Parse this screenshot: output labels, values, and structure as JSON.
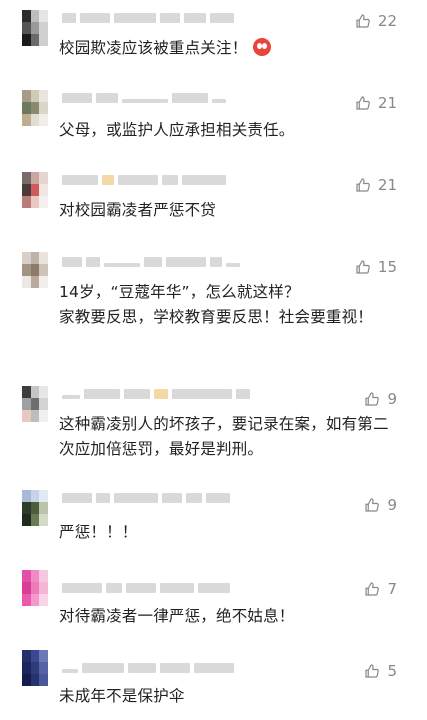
{
  "comments": [
    {
      "likes": "22",
      "text": "校园欺凌应该被重点关注！",
      "emoji": "angry-face-icon",
      "avatar": [
        "#2b2b2b",
        "#bdbdbd",
        "#e5e5e5",
        "#555",
        "#9a9a9a",
        "#d0d0d0",
        "#1a1a1a",
        "#6b6b6b",
        "#cfcfcf"
      ]
    },
    {
      "likes": "21",
      "text": "父母，或监护人应承担相关责任。",
      "avatar": [
        "#a79d86",
        "#cfcab8",
        "#e8e5dc",
        "#6d7a5e",
        "#8a8a6e",
        "#d9d6cc",
        "#bfae92",
        "#e2ddd2",
        "#f0eee8"
      ]
    },
    {
      "likes": "21",
      "text": "对校园霸凌者严惩不贷",
      "avatar": [
        "#7a6a6a",
        "#c9a7a0",
        "#e6d6d2",
        "#4b3c3c",
        "#d35a5a",
        "#efe5e3",
        "#b97c76",
        "#e8c9c3",
        "#f5efee"
      ]
    },
    {
      "likes": "15",
      "text": "14岁，“豆蔻年华”，怎么就这样？\n家教要反思，学校教育要反思！社会要重视！",
      "avatar": [
        "#d8d0c8",
        "#bfb3a6",
        "#e9e4df",
        "#a39383",
        "#8b7b6b",
        "#cdc3b8",
        "#ece8e4",
        "#b8aa9c",
        "#f2efec"
      ]
    },
    {
      "likes": "9",
      "text": "这种霸凌别人的坏孩子，要记录在案，如有第二次应加倍惩罚，最好是判刑。",
      "avatar": [
        "#3d3d3d",
        "#c5c5c5",
        "#e7e7e7",
        "#a0a0a0",
        "#6e6e6e",
        "#d4d4d4",
        "#e9c8c0",
        "#bdbdbd",
        "#f0f0f0"
      ]
    },
    {
      "likes": "9",
      "text": "严惩！！！",
      "avatar": [
        "#a9b9d6",
        "#c6d3e8",
        "#e3e9f3",
        "#2f3b2a",
        "#4e5d3c",
        "#b9c4a8",
        "#1f2a1c",
        "#6a7a55",
        "#d3dac8"
      ]
    },
    {
      "likes": "7",
      "text": "对待霸凌者一律严惩，绝不姑息！",
      "avatar": [
        "#e64fa6",
        "#f08bc4",
        "#f7c6e0",
        "#d93d98",
        "#ee7ab8",
        "#f4b6d6",
        "#e95aa9",
        "#f29acb",
        "#fad4e8"
      ]
    },
    {
      "likes": "5",
      "text": "未成年不是保护伞",
      "avatar": [
        "#25306b",
        "#3b4a8f",
        "#6d78b5",
        "#1c2560",
        "#2e3c7d",
        "#5563a6",
        "#141c4f",
        "#26336f",
        "#4a579a"
      ]
    }
  ]
}
